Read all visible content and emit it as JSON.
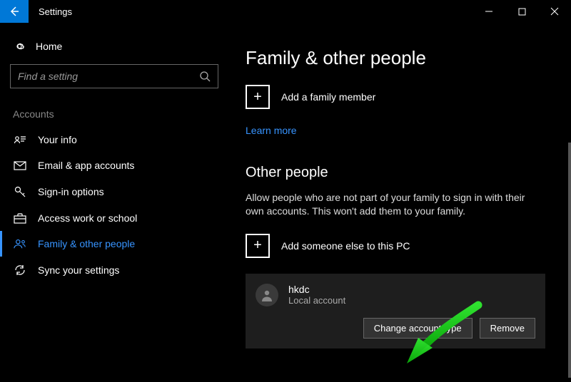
{
  "title": "Settings",
  "home_label": "Home",
  "search": {
    "placeholder": "Find a setting"
  },
  "section": "Accounts",
  "nav": [
    {
      "label": "Your info"
    },
    {
      "label": "Email & app accounts"
    },
    {
      "label": "Sign-in options"
    },
    {
      "label": "Access work or school"
    },
    {
      "label": "Family & other people"
    },
    {
      "label": "Sync your settings"
    }
  ],
  "main": {
    "title": "Family & other people",
    "add_family": "Add a family member",
    "learn_more": "Learn more",
    "other_people_heading": "Other people",
    "other_people_text": "Allow people who are not part of your family to sign in with their own accounts. This won't add them to your family.",
    "add_someone": "Add someone else to this PC",
    "account": {
      "name": "hkdc",
      "type": "Local account",
      "change_btn": "Change account type",
      "remove_btn": "Remove"
    }
  }
}
